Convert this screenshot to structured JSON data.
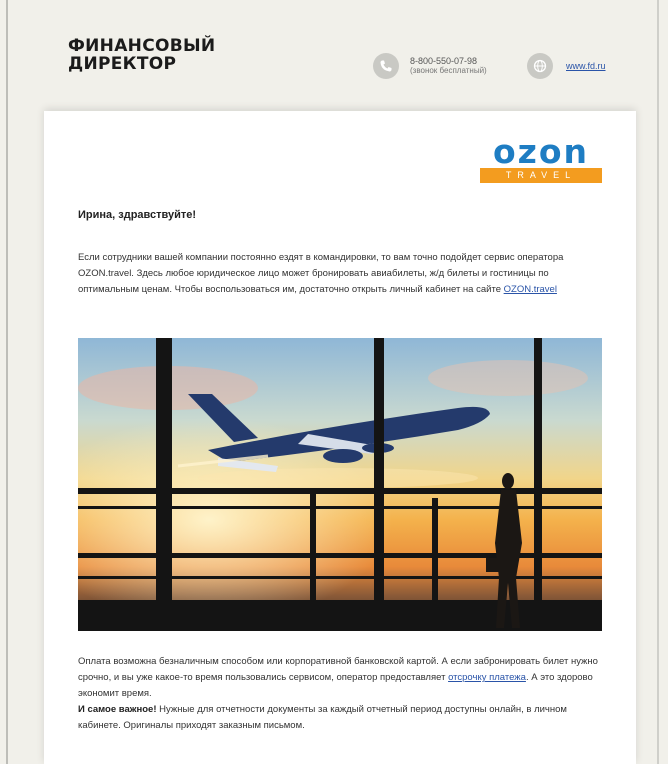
{
  "header": {
    "logo_line1": "ФИНАНСОВЫЙ",
    "logo_line2": "ДИРЕКТОР",
    "phone": "8-800-550-07-98",
    "phone_note": "(звонок бесплатный)",
    "site_link": "www.fd.ru"
  },
  "ozon": {
    "word": "ozon",
    "sub": "TRAVEL",
    "brand_blue": "#1e7dc3",
    "brand_orange": "#f39c1f"
  },
  "email": {
    "greeting": "Ирина, здравствуйте!",
    "para1_text": "Если сотрудники вашей компании постоянно ездят в командировки, то вам точно подойдет сервис оператора OZON.travel. Здесь любое юридическое лицо может бронировать авиабилеты, ж/д билеты и гостиницы по оптимальным ценам. Чтобы воспользоваться им, достаточно открыть личный кабинет на сайте ",
    "para1_link": "OZON.travel",
    "para2_text": "Оплата возможна безналичным способом или корпоративной банковской картой. А если забронировать билет нужно срочно, и вы уже какое-то время пользовались сервисом, оператор предоставляет ",
    "para2_link": "отсрочку платежа",
    "para2_tail": ". А это здорово экономит время.",
    "para3_bold": "И самое важное!",
    "para3_text": " Нужные для отчетности документы за каждый отчетный период доступны онлайн, в личном кабинете. Оригиналы приходят заказным письмом."
  },
  "icons": {
    "phone": "phone-icon",
    "web": "globe-icon"
  }
}
